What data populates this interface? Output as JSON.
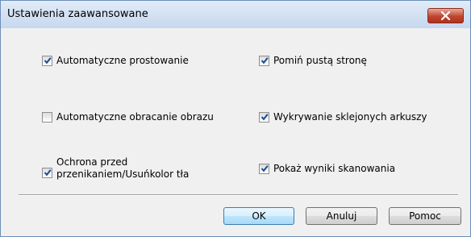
{
  "window": {
    "title": "Ustawienia zaawansowane"
  },
  "options": {
    "left": [
      {
        "label": "Automatyczne prostowanie",
        "checked": true
      },
      {
        "label": "Automatyczne obracanie obrazu",
        "checked": false
      },
      {
        "label": "Ochrona przed przenikaniem/Usuńkolor tła",
        "checked": true
      }
    ],
    "right": [
      {
        "label": "Pomiń pustą stronę",
        "checked": true
      },
      {
        "label": "Wykrywanie sklejonych arkuszy",
        "checked": true
      },
      {
        "label": "Pokaż wyniki skanowania",
        "checked": true
      }
    ]
  },
  "buttons": {
    "ok": "OK",
    "cancel": "Anuluj",
    "help": "Pomoc"
  },
  "colors": {
    "checkmark": "#1a4a9a",
    "close_button": "#c0452f"
  }
}
